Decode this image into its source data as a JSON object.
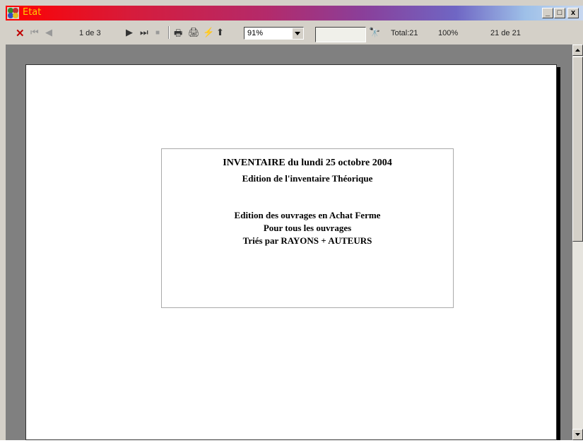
{
  "window": {
    "title": "Etat",
    "title_color": "#ffcc00",
    "accent_red": "#ff0000"
  },
  "controls": {
    "minimize": "_",
    "maximize": "□",
    "close": "x"
  },
  "toolbar": {
    "close_icon": "close-icon",
    "page_indicator": "1 de 3",
    "zoom_value": "91%",
    "search_value": "",
    "total_label": "Total:21",
    "percent_label": "100%",
    "record_label": "21 de 21"
  },
  "report": {
    "line1": "INVENTAIRE du lundi 25 octobre 2004",
    "line2": "Edition de l'inventaire Théorique",
    "line3": "Edition des ouvrages en Achat Ferme",
    "line4": "Pour tous les ouvrages",
    "line5": "Triés par RAYONS + AUTEURS"
  }
}
